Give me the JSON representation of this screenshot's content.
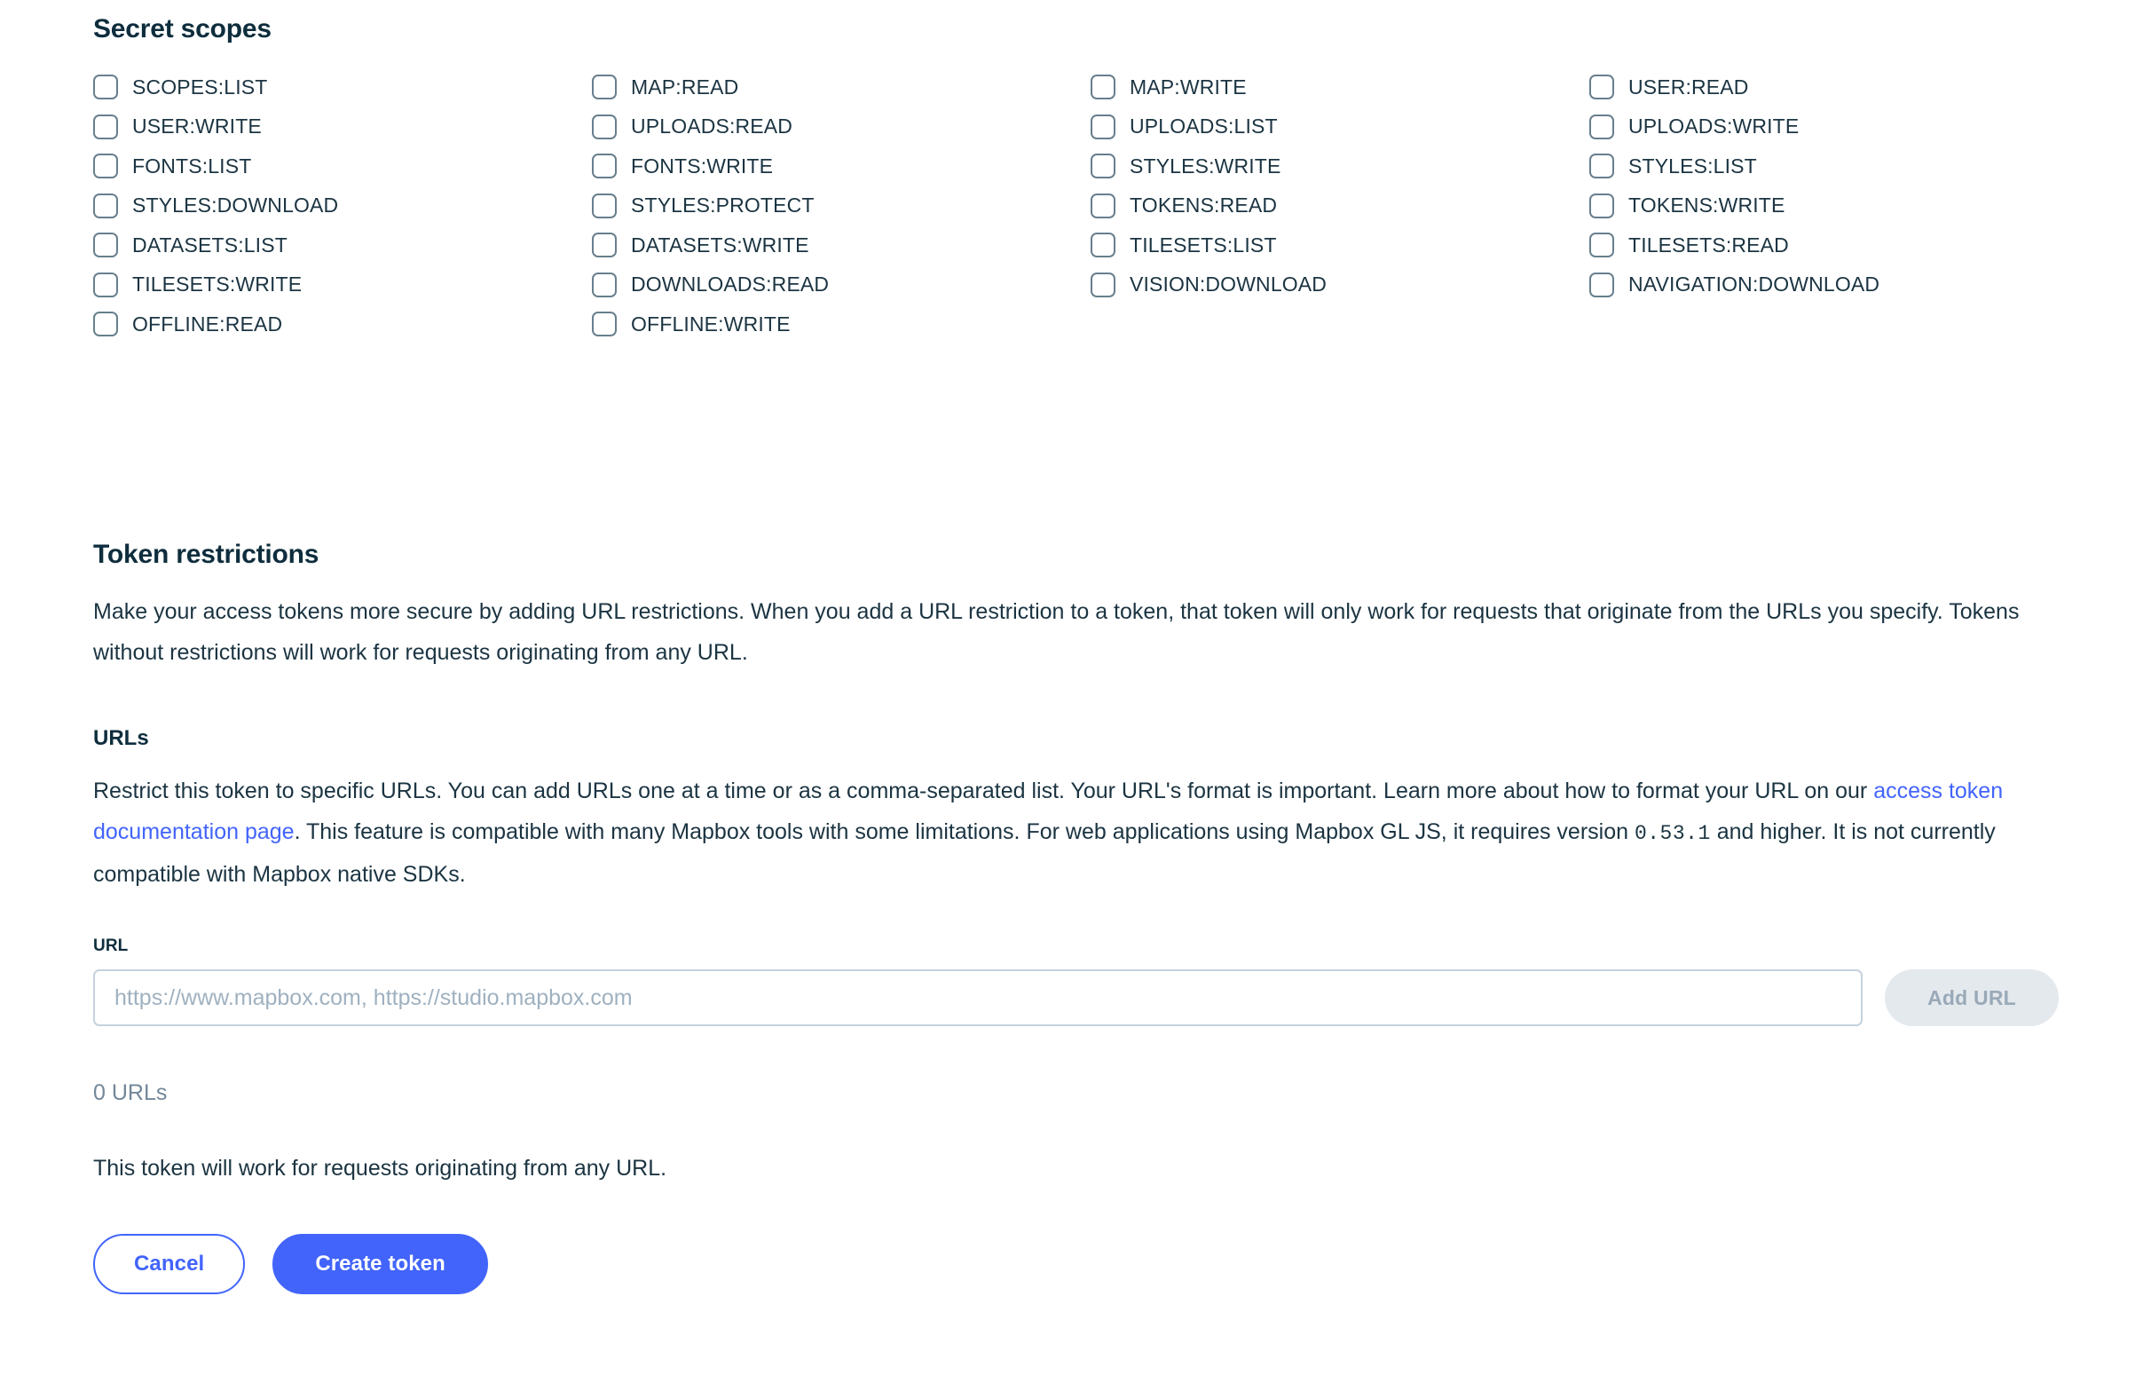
{
  "secret_scopes": {
    "title": "Secret scopes",
    "items": [
      "SCOPES:LIST",
      "MAP:READ",
      "MAP:WRITE",
      "USER:READ",
      "USER:WRITE",
      "UPLOADS:READ",
      "UPLOADS:LIST",
      "UPLOADS:WRITE",
      "FONTS:LIST",
      "FONTS:WRITE",
      "STYLES:WRITE",
      "STYLES:LIST",
      "STYLES:DOWNLOAD",
      "STYLES:PROTECT",
      "TOKENS:READ",
      "TOKENS:WRITE",
      "DATASETS:LIST",
      "DATASETS:WRITE",
      "TILESETS:LIST",
      "TILESETS:READ",
      "TILESETS:WRITE",
      "DOWNLOADS:READ",
      "VISION:DOWNLOAD",
      "NAVIGATION:DOWNLOAD",
      "OFFLINE:READ",
      "OFFLINE:WRITE"
    ]
  },
  "token_restrictions": {
    "title": "Token restrictions",
    "description": "Make your access tokens more secure by adding URL restrictions. When you add a URL restriction to a token, that token will only work for requests that originate from the URLs you specify. Tokens without restrictions will work for requests originating from any URL."
  },
  "urls": {
    "title": "URLs",
    "description_part1": "Restrict this token to specific URLs. You can add URLs one at a time or as a comma-separated list. Your URL's format is important. Learn more about how to format your URL on our ",
    "link_label": "access token documentation page",
    "description_part2": ". This feature is compatible with many Mapbox tools with some limitations. For web applications using Mapbox GL JS, it requires version ",
    "version": "0.53.1",
    "description_part3": " and higher. It is not currently compatible with Mapbox native SDKs.",
    "field_label": "URL",
    "input_value": "",
    "input_placeholder": "https://www.mapbox.com, https://studio.mapbox.com",
    "add_button_label": "Add URL",
    "count_text": "0 URLs",
    "note": "This token will work for requests originating from any URL."
  },
  "actions": {
    "cancel_label": "Cancel",
    "create_label": "Create token"
  },
  "colors": {
    "accent": "#4264fb",
    "text": "#1b3442",
    "heading": "#0e2d3d",
    "muted": "#73879a",
    "checkbox_border": "#687f8d",
    "input_border": "#c5d2de",
    "disabled_bg": "#e4e9ee",
    "disabled_text": "#9aa9b8"
  }
}
